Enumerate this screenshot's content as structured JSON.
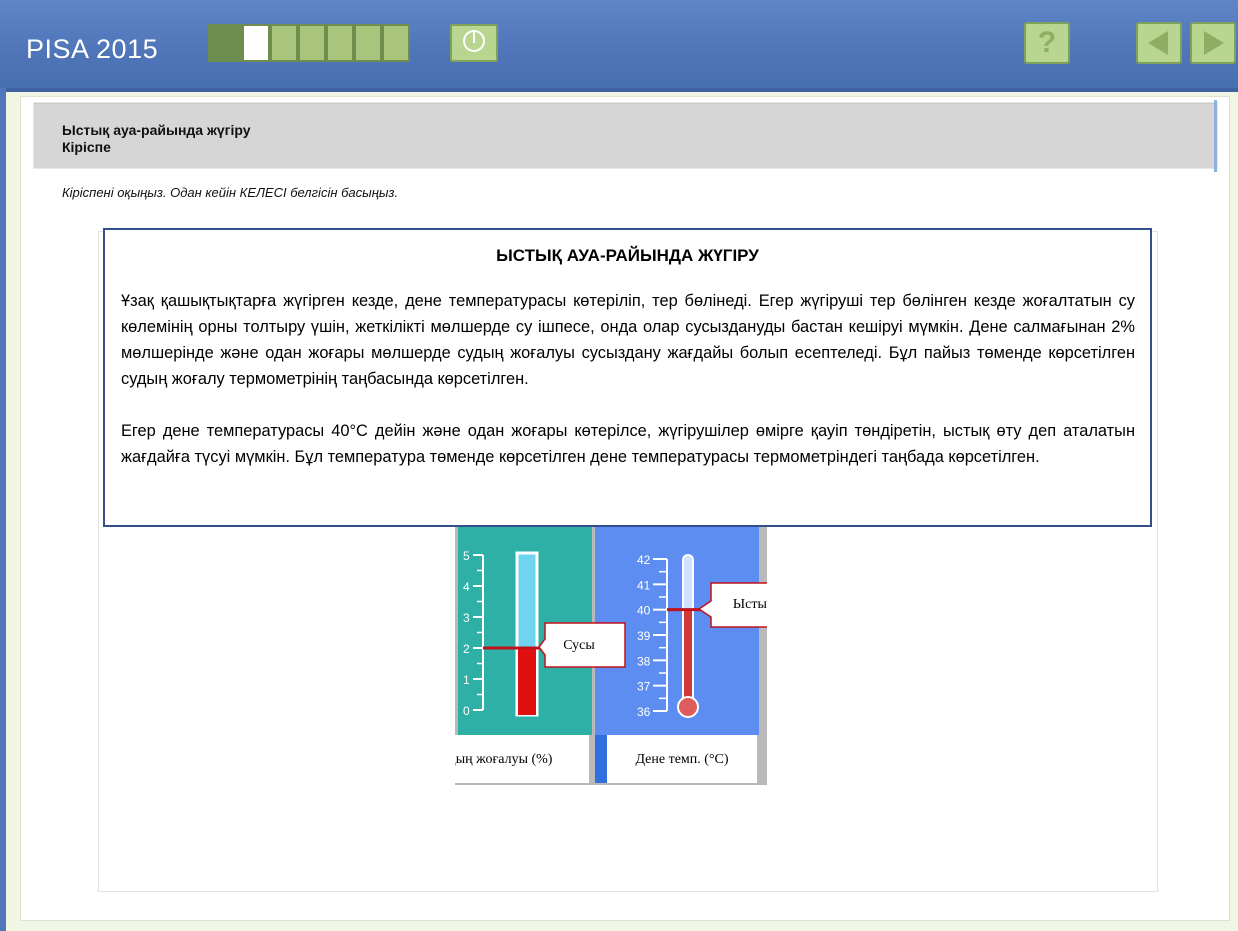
{
  "app": {
    "brand": "PISA 2015",
    "progress": {
      "total_cells": 8,
      "completed": 1,
      "current_index": 2
    }
  },
  "toolbar": {
    "help_label": "?",
    "timer_icon": "clock-icon",
    "prev_icon": "triangle-left-icon",
    "next_icon": "triangle-right-icon"
  },
  "header": {
    "title": "Ыстық ауа-райында жүгіру",
    "subtitle": "Кіріспе"
  },
  "instruction": "Кіріспені оқыңыз. Одан кейін КЕЛЕСІ белгісін басыңыз.",
  "article": {
    "heading": "ЫСТЫҚ АУА-РАЙЫНДА ЖҮГІРУ",
    "paragraph1": "Ұзақ қашықтықтарға жүгірген кезде, дене температурасы көтеріліп, тер бөлінеді. Егер жүгіруші тер бөлінген кезде жоғалтатын су көлемінің орны толтыру үшін, жеткілікті мөлшерде су ішпесе, онда олар сусыздануды бастан кешіруі мүмкін. Дене салмағынан 2% мөлшерінде және одан жоғары мөлшерде судың жоғалуы сусыздану жағдайы болып есептеледі. Бұл пайыз төменде көрсетілген судың жоғалу термометрінің таңбасында көрсетілген.",
    "paragraph2": "Егер дене температурасы 40°C дейін және одан жоғары көтерілсе, жүгірушілер өмірге қауіп төндіретін, ыстық өту деп аталатын жағдайға түсуі мүмкін. Бұл температура төменде көрсетілген дене температурасы термометріндегі таңбада көрсетілген."
  },
  "figure": {
    "water_loss": {
      "label": "Судың жоғалуы (%)",
      "ticks": [
        "0",
        "1",
        "2",
        "3",
        "4",
        "5"
      ],
      "min": 0,
      "max": 5,
      "fill_value": 2,
      "marker_label": "Сусы",
      "colors": {
        "panel": "#2fb0a6",
        "tube": "#6fd4ef",
        "fill": "#e01010",
        "marker": "#c0121a"
      }
    },
    "body_temp": {
      "label": "Дене  темп. (°C)",
      "ticks": [
        "36",
        "37",
        "38",
        "39",
        "40",
        "41",
        "42"
      ],
      "min": 36,
      "max": 42,
      "fill_value": 40,
      "marker_label": "Ыстық өту",
      "colors": {
        "panel": "#5d8df0",
        "tube": "#cfe3ff",
        "fill": "#d23a3a",
        "marker": "#c0121a"
      }
    }
  }
}
